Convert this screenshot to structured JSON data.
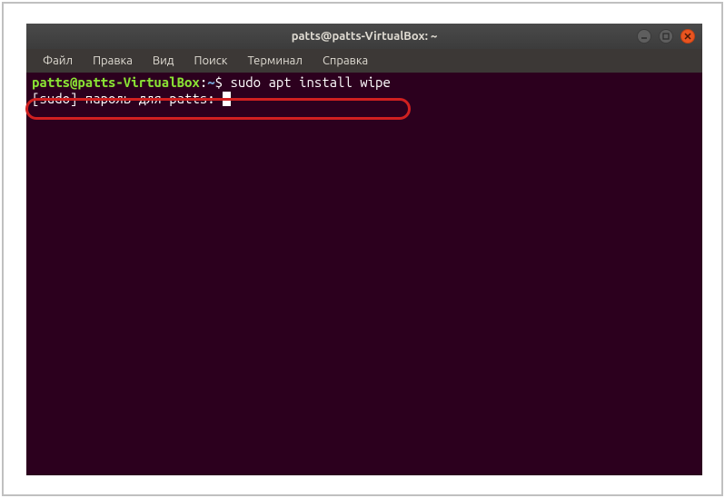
{
  "window": {
    "title": "patts@patts-VirtualBox: ~"
  },
  "menu": {
    "items": [
      "Файл",
      "Правка",
      "Вид",
      "Поиск",
      "Терминал",
      "Справка"
    ]
  },
  "terminal": {
    "prompt": {
      "user_host": "patts@patts-VirtualBox",
      "colon": ":",
      "path": "~",
      "dollar": "$"
    },
    "command": "sudo apt install wipe",
    "sudo_prompt": "[sudo] пароль для patts: "
  }
}
